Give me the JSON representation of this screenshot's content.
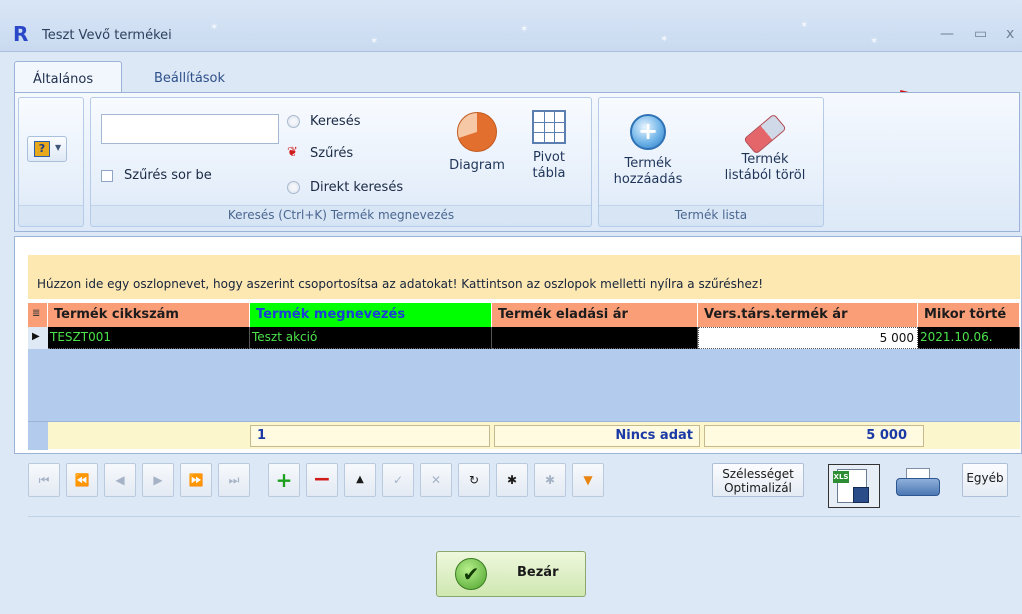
{
  "window": {
    "logo": "R",
    "title": "Teszt Vevő termékei",
    "minimize_glyph": "—",
    "maximize_glyph": "▭",
    "close_glyph": "x"
  },
  "tabs": [
    {
      "label": "Általános",
      "active": true
    },
    {
      "label": "Beállítások",
      "active": false
    }
  ],
  "ribbon": {
    "search_group": {
      "input_value": "",
      "filter_row_label": "Szűrés sor be",
      "radio_search": "Keresés",
      "radio_filter": "Szűrés",
      "radio_direct": "Direkt keresés",
      "diagram_label": "Diagram",
      "pivot_label_1": "Pivot",
      "pivot_label_2": "tábla",
      "group_label": "Keresés (Ctrl+K) Termék megnevezés"
    },
    "product_group": {
      "add_label_1": "Termék",
      "add_label_2": "hozzáadás",
      "remove_label_1": "Termék",
      "remove_label_2": "listából töröl",
      "group_label": "Termék lista"
    }
  },
  "grid": {
    "group_panel_text": "Húzzon ide egy oszlopnevet, hogy aszerint csoportosítsa az adatokat! Kattintson az oszlopok melletti nyílra a szűréshez!",
    "columns": [
      "Termék cikkszám",
      "Termék megnevezés",
      "Termék eladási ár",
      "Vers.társ.termék ár",
      "Mikor törté"
    ],
    "rows": [
      {
        "cikkszam": "TESZT001",
        "megnevezes": "Teszt akció",
        "eladasi_ar": "",
        "vers_ar": "5 000",
        "mikor": "2021.10.06."
      }
    ],
    "footer": {
      "count": "1",
      "no_data": "Nincs adat",
      "sum": "5 000"
    }
  },
  "nav": {
    "first": "⏮",
    "prev_page": "⏪",
    "prev": "◀",
    "next": "▶",
    "next_page": "⏩",
    "last": "⏭",
    "add": "+",
    "delete": "−",
    "up": "▲",
    "confirm": "✓",
    "cancel": "✕",
    "refresh": "↻",
    "star": "✱",
    "star2": "✱",
    "filter": "▼",
    "width_label_1": "Szélességet",
    "width_label_2": "Optimalizál",
    "other_label": "Egyéb"
  },
  "close_button": {
    "label": "Bezár",
    "check": "✔"
  },
  "colors": {
    "header_orange": "#fa9e78",
    "header_green": "#00ff00",
    "row_black": "#000000",
    "row_text_green": "#4ce24c",
    "group_panel": "#fde8b2"
  }
}
